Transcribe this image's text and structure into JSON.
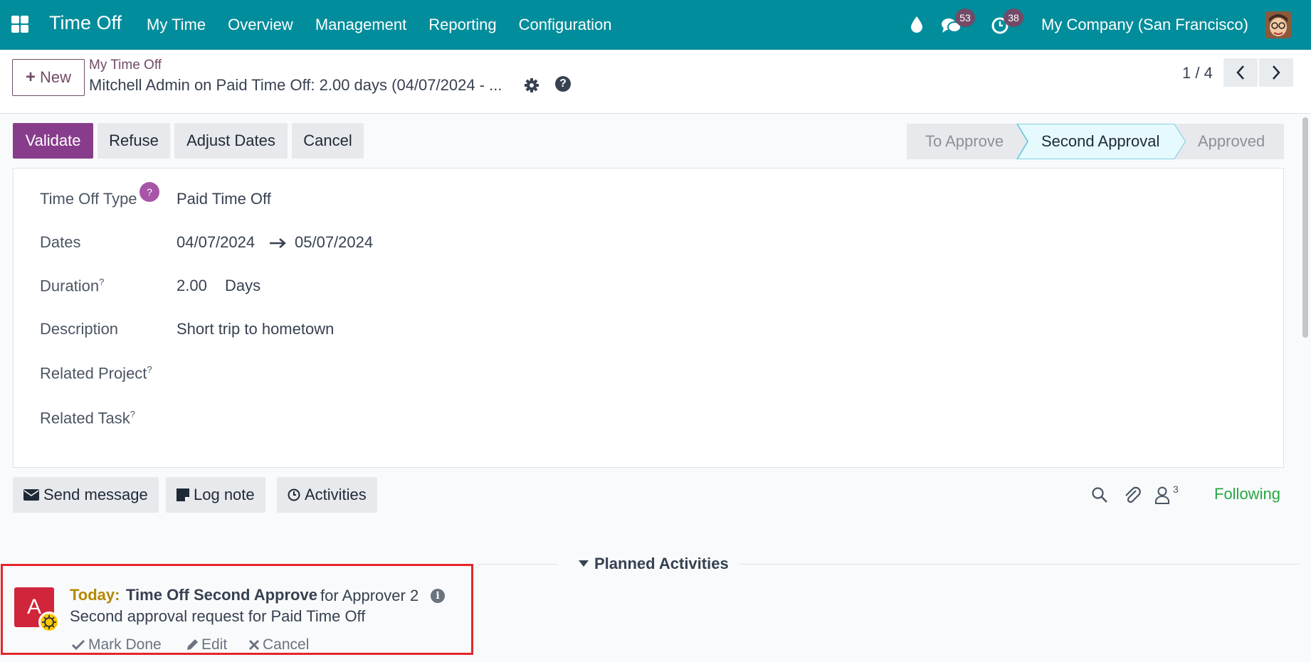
{
  "nav": {
    "app_title": "Time Off",
    "menu": [
      "My Time",
      "Overview",
      "Management",
      "Reporting",
      "Configuration"
    ],
    "messages_count": "53",
    "activities_count": "38",
    "company": "My Company (San Francisco)"
  },
  "control": {
    "new_label": "New",
    "breadcrumb_parent": "My Time Off",
    "breadcrumb_current": "Mitchell Admin on Paid Time Off: 2.00 days (04/07/2024 - ...",
    "pager": "1 / 4"
  },
  "actions": {
    "validate": "Validate",
    "refuse": "Refuse",
    "adjust_dates": "Adjust Dates",
    "cancel": "Cancel"
  },
  "status": {
    "stages": [
      "To Approve",
      "Second Approval",
      "Approved"
    ],
    "active": "Second Approval"
  },
  "form": {
    "type_label": "Time Off Type",
    "type_help": "?",
    "type_value": "Paid Time Off",
    "dates_label": "Dates",
    "date_from": "04/07/2024",
    "date_to": "05/07/2024",
    "duration_label": "Duration",
    "duration_value": "2.00",
    "duration_unit": "Days",
    "description_label": "Description",
    "description_value": "Short trip to hometown",
    "related_project_label": "Related Project",
    "related_task_label": "Related Task",
    "tooltip_mark": "?"
  },
  "chatter": {
    "send_message": "Send message",
    "log_note": "Log note",
    "activities": "Activities",
    "followers_count": "3",
    "following": "Following",
    "planned_activities": "Planned Activities"
  },
  "activity": {
    "avatar_letter": "A",
    "due": "Today:",
    "title": "Time Off Second Approve",
    "assigned": "for Approver 2",
    "summary": "Second approval request for Paid Time Off",
    "mark_done": "Mark Done",
    "edit": "Edit",
    "cancel": "Cancel"
  }
}
